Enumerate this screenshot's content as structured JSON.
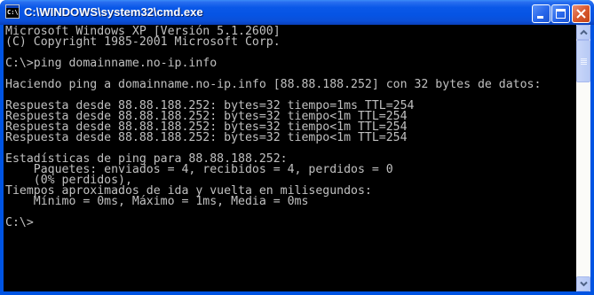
{
  "window": {
    "title": "C:\\WINDOWS\\system32\\cmd.exe",
    "icon_label": "C:\\",
    "controls": [
      "minimize-icon",
      "maximize-icon",
      "close-icon"
    ]
  },
  "console": {
    "lines": [
      "Microsoft Windows XP [Versión 5.1.2600]",
      "(C) Copyright 1985-2001 Microsoft Corp.",
      "",
      "C:\\>ping domainname.no-ip.info",
      "",
      "Haciendo ping a domainname.no-ip.info [88.88.188.252] con 32 bytes de datos:",
      "",
      "Respuesta desde 88.88.188.252: bytes=32 tiempo=1ms TTL=254",
      "Respuesta desde 88.88.188.252: bytes=32 tiempo<1m TTL=254",
      "Respuesta desde 88.88.188.252: bytes=32 tiempo<1m TTL=254",
      "Respuesta desde 88.88.188.252: bytes=32 tiempo<1m TTL=254",
      "",
      "Estadísticas de ping para 88.88.188.252:",
      "    Paquetes: enviados = 4, recibidos = 4, perdidos = 0",
      "    (0% perdidos),",
      "Tiempos aproximados de ida y vuelta en milisegundos:",
      "    Mínimo = 0ms, Máximo = 1ms, Media = 0ms",
      "",
      "C:\\>"
    ]
  },
  "colors": {
    "titlebar": "#0054e3",
    "console_bg": "#000000",
    "console_text": "#c0c0c0",
    "close_button": "#d9582e"
  }
}
